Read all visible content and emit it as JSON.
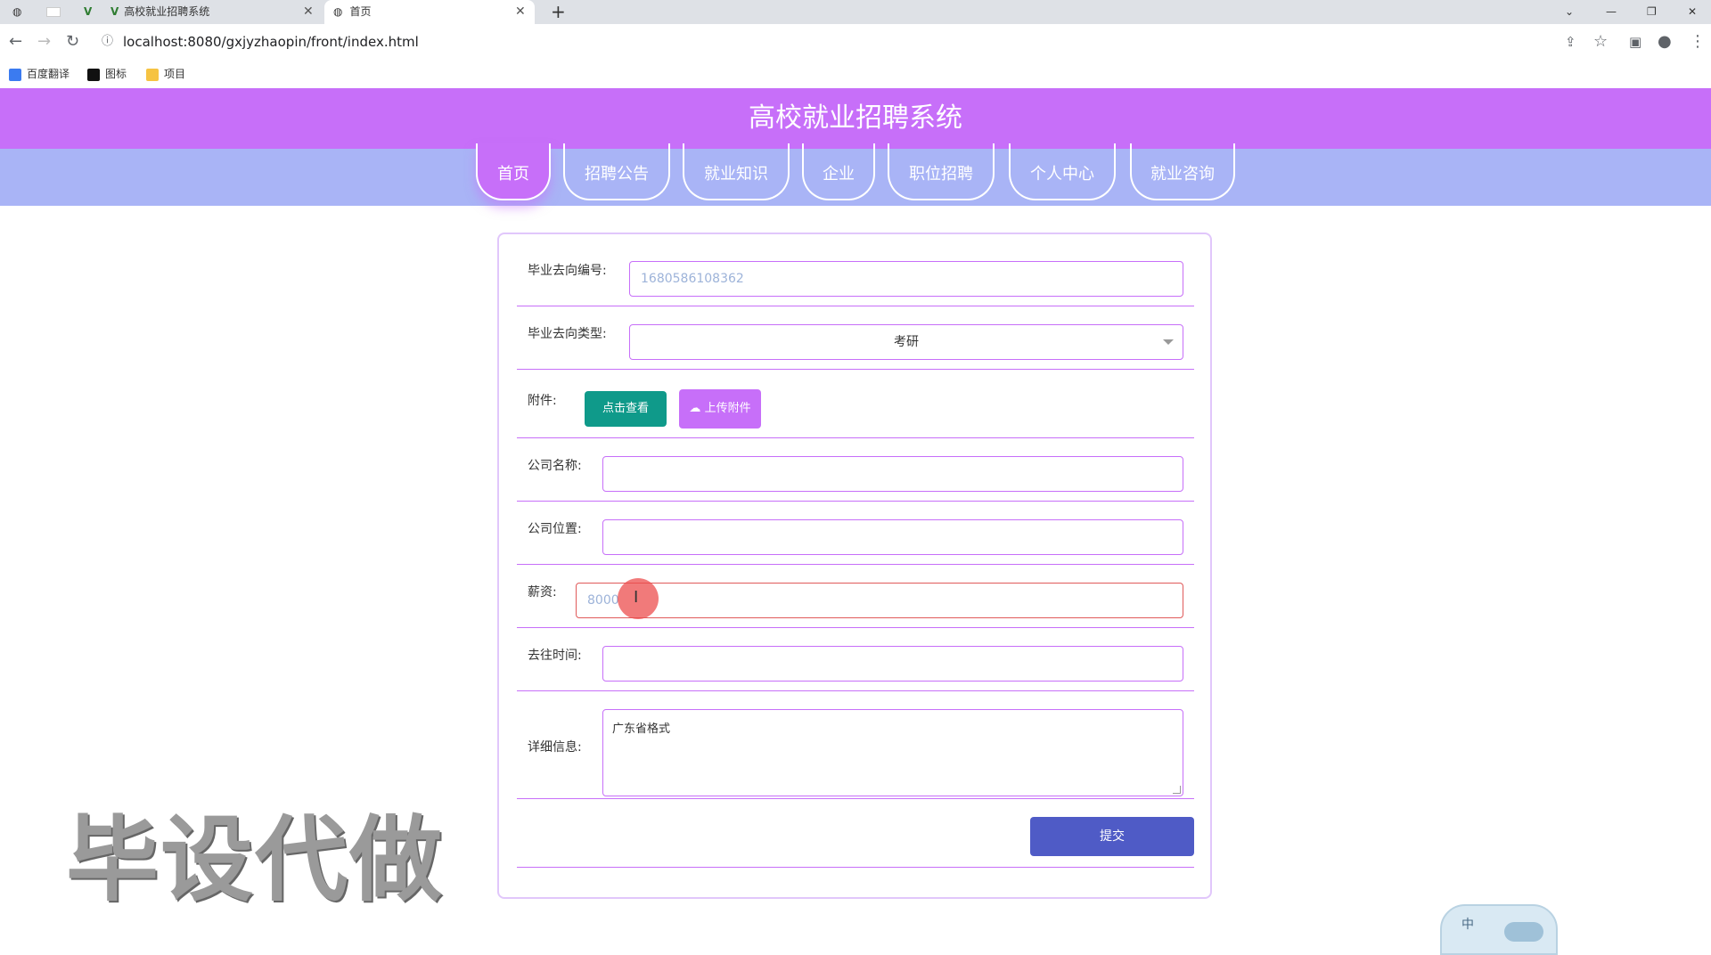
{
  "browser": {
    "tabs": [
      {
        "label": ""
      },
      {
        "label": ""
      },
      {
        "label": "高校就业招聘系统"
      },
      {
        "label": "首页"
      }
    ],
    "new_tab": "+",
    "url": "localhost:8080/gxjyzhaopin/front/index.html",
    "bookmarks": [
      "百度翻译",
      "图标",
      "项目"
    ]
  },
  "site": {
    "title": "高校就业招聘系统",
    "nav": [
      "首页",
      "招聘公告",
      "就业知识",
      "企业",
      "职位招聘",
      "个人中心",
      "就业咨询"
    ],
    "active_nav": 0
  },
  "form": {
    "id_label": "毕业去向编号:",
    "id_value": "1680586108362",
    "type_label": "毕业去向类型:",
    "type_value": "考研",
    "attach_label": "附件:",
    "view_button": "点击查看",
    "upload_button": "上传附件",
    "company_label": "公司名称:",
    "company_value": "",
    "location_label": "公司位置:",
    "location_value": "",
    "salary_label": "薪资:",
    "salary_value": "8000",
    "time_label": "去往时间:",
    "time_value": "",
    "detail_label": "详细信息:",
    "detail_value": "广东省格式",
    "submit_button": "提交"
  },
  "watermark": "毕设代做",
  "ime": {
    "label": "中"
  },
  "colors": {
    "header": "#c76ff9",
    "navbar": "#a9b4f6",
    "view_button": "#0f9a8a",
    "upload_button": "#c76ff9",
    "submit_button": "#4f5bc6",
    "error_border": "#e05a5a"
  }
}
